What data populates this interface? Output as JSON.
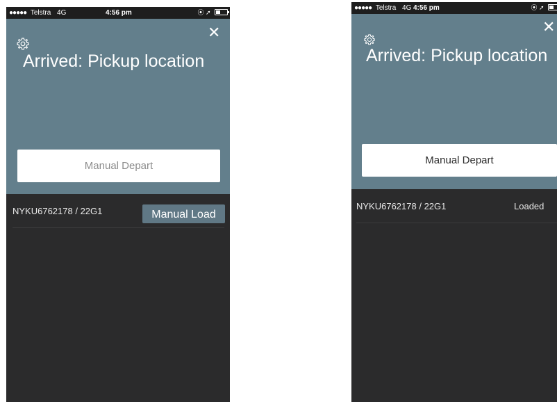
{
  "screens": [
    {
      "status_bar": {
        "signal": "●●●●●",
        "carrier": "Telstra",
        "network": "4G",
        "time": "4:56 pm",
        "indicators": "⦿ ➚"
      },
      "header": {
        "title": "Arrived: Pickup location",
        "settings_icon": "gear-icon",
        "close_icon": "close-icon",
        "close_glyph": "✕"
      },
      "depart_button_label": "Manual Depart",
      "container": {
        "id_text": "NYKU6762178 / 22G1",
        "load_button_label": "Manual Load"
      }
    },
    {
      "status_bar": {
        "signal": "●●●●●",
        "carrier": "Telstra",
        "network": "4G",
        "time": "4:56 pm",
        "indicators": "⦿ ➚"
      },
      "header": {
        "title": "Arrived: Pickup location",
        "settings_icon": "gear-icon",
        "close_icon": "close-icon",
        "close_glyph": "✕"
      },
      "depart_button_label": "Manual Depart",
      "container": {
        "id_text": "NYKU6762178 / 22G1",
        "status_text": "Loaded"
      }
    }
  ],
  "colors": {
    "header_bg": "#637f8c",
    "body_bg": "#2b2b2c",
    "status_bar_bg": "#1e1e1e",
    "load_button_bg": "#607885"
  }
}
